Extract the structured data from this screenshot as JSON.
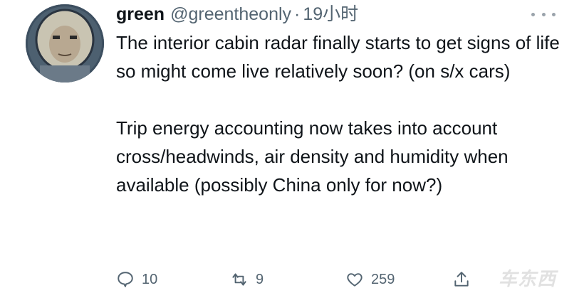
{
  "user": {
    "name": "green",
    "handle": "@greentheonly",
    "separator": "·",
    "time": "19小时"
  },
  "tweet": {
    "paragraph1": "The interior cabin radar finally starts to get signs of life so might come live relatively soon? (on s/x cars)",
    "paragraph2": "Trip energy accounting now takes into account cross/headwinds, air density and humidity when available (possibly China only for now?)"
  },
  "actions": {
    "replies": "10",
    "retweets": "9",
    "likes": "259"
  },
  "watermark": "车东西",
  "icons": [
    "more-icon",
    "reply-icon",
    "retweet-icon",
    "like-icon",
    "share-icon"
  ]
}
